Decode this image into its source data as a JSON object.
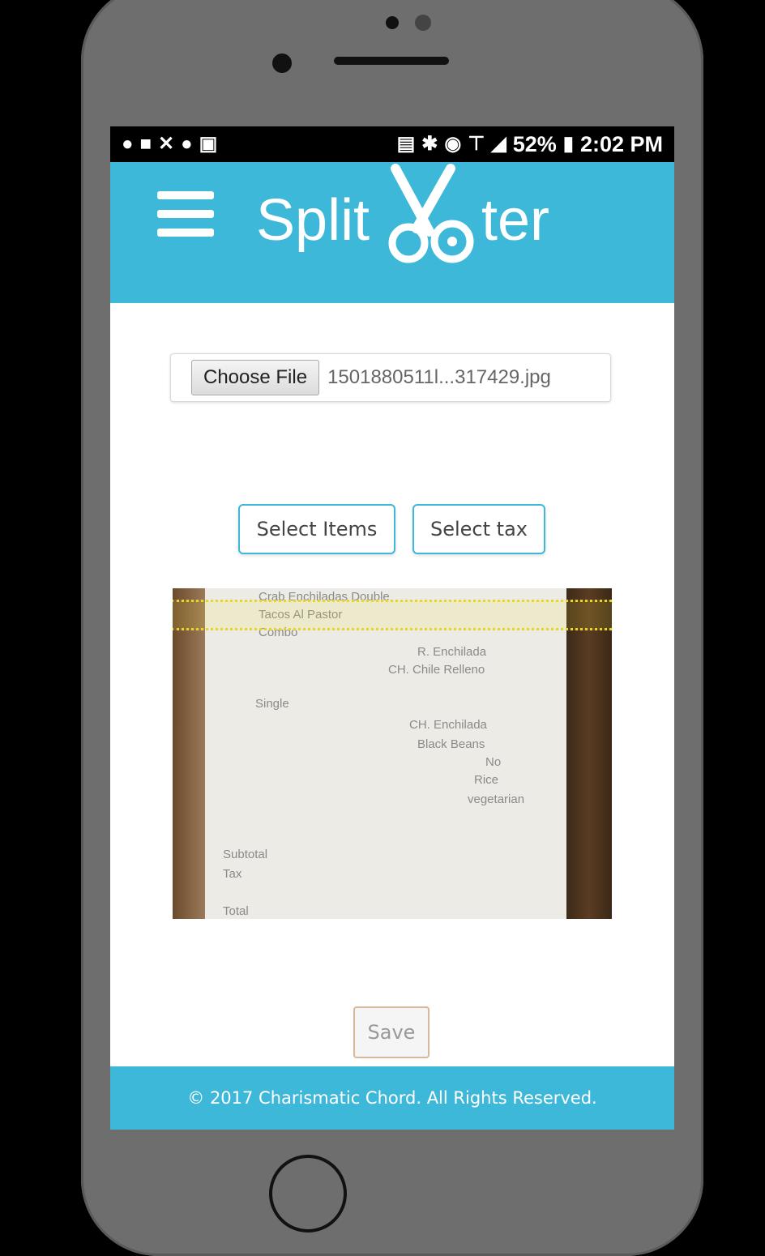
{
  "status_bar": {
    "left_icons": [
      "messenger-icon",
      "chat-icon",
      "missed-call-icon",
      "whatsapp-icon",
      "gallery-icon"
    ],
    "right_icons": [
      "cast-icon",
      "bluetooth-icon",
      "alarm-icon",
      "wifi-icon",
      "signal-icon"
    ],
    "battery": "52%",
    "time": "2:02 PM"
  },
  "header": {
    "logo_left": "Split",
    "logo_right": "ter",
    "menu_icon": "hamburger-icon",
    "accent_color": "#3db8d9"
  },
  "file_input": {
    "button_label": "Choose File",
    "file_name": "1501880511l...317429.jpg"
  },
  "actions": {
    "select_items_label": "Select Items",
    "select_tax_label": "Select tax"
  },
  "receipt": {
    "lines": [
      "Crab Enchiladas Double",
      "Tacos Al Pastor",
      "Combo",
      "R. Enchilada",
      "CH. Chile Relleno",
      "Single",
      "CH. Enchilada",
      "Black Beans",
      "No",
      "Rice",
      "vegetarian",
      "Subtotal",
      "Tax",
      "Total"
    ]
  },
  "save_label": "Save",
  "footer_text": "© 2017 Charismatic Chord. All Rights Reserved."
}
